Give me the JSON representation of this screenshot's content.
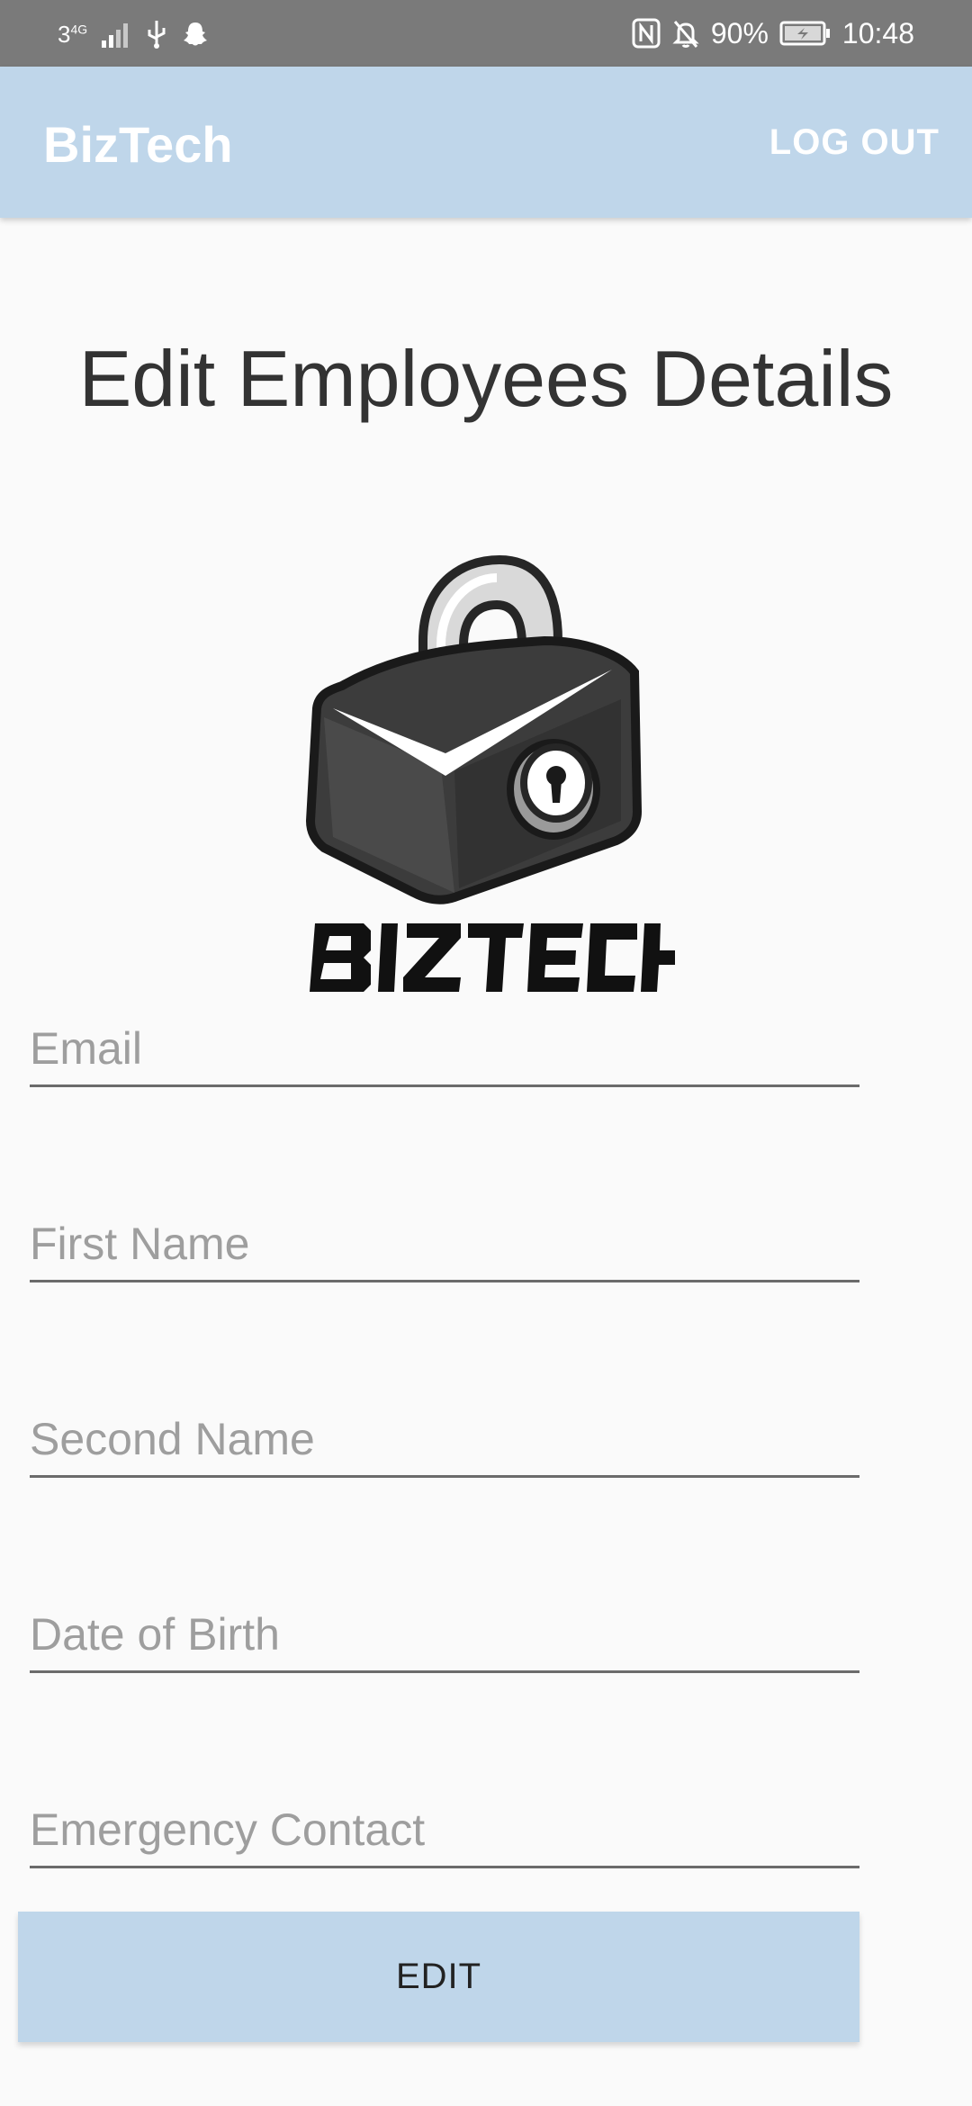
{
  "status_bar": {
    "carrier_signal": "3",
    "network_type": "4G",
    "battery_percent": "90%",
    "time": "10:48",
    "icons": [
      "signal-icon",
      "usb-icon",
      "snapchat-icon",
      "nfc-icon",
      "bell-off-icon",
      "battery-charging-icon"
    ]
  },
  "app_bar": {
    "title": "BizTech",
    "logout_label": "LOG OUT"
  },
  "page": {
    "title": "Edit Employees Details"
  },
  "logo": {
    "icon": "padlock-icon"
  },
  "form": {
    "email": {
      "placeholder": "Email",
      "value": ""
    },
    "first_name": {
      "placeholder": "First Name",
      "value": ""
    },
    "second_name": {
      "placeholder": "Second Name",
      "value": ""
    },
    "date_of_birth": {
      "placeholder": "Date of Birth",
      "value": ""
    },
    "emergency_contact": {
      "placeholder": "Emergency Contact",
      "value": ""
    },
    "submit_label": "EDIT"
  },
  "colors": {
    "primary": "#bfd6ea",
    "status_bar": "#7a7a7a",
    "background": "#fafafa",
    "text_dark": "#333333",
    "placeholder": "#9e9e9e"
  }
}
